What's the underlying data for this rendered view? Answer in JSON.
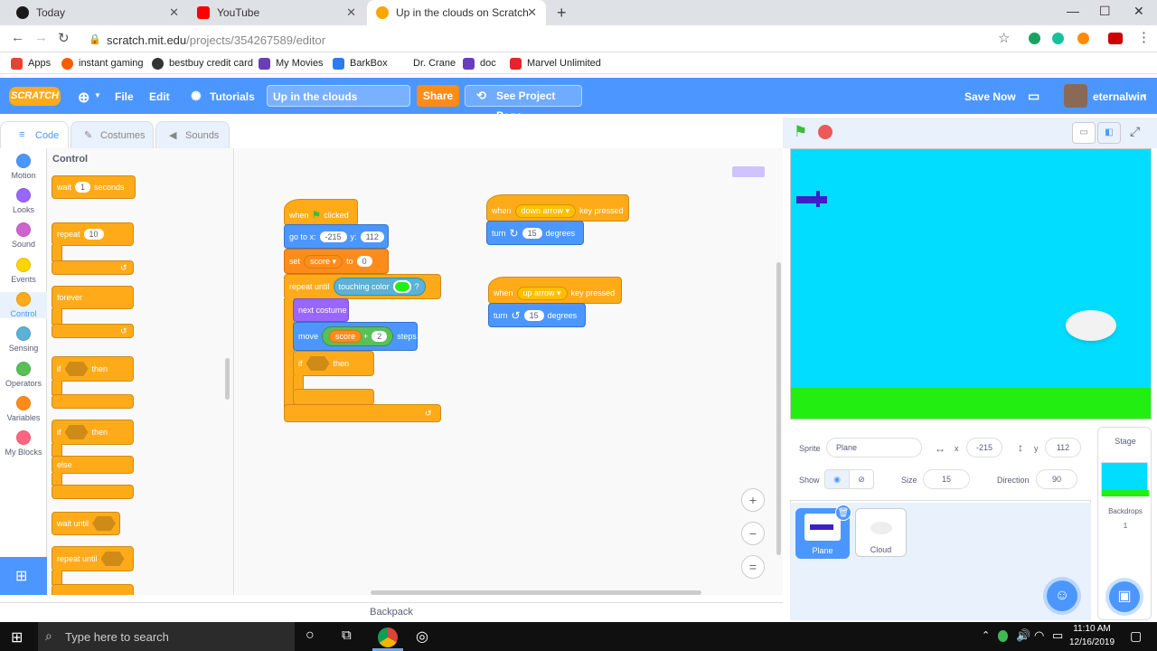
{
  "browser": {
    "tabs": [
      {
        "title": "Today",
        "icon_color": "#1a1a1a"
      },
      {
        "title": "YouTube",
        "icon_color": "#ff0000"
      },
      {
        "title": "Up in the clouds on Scratch",
        "icon_color": "#ffa500"
      }
    ],
    "url_host": "scratch.mit.edu",
    "url_path": "/projects/354267589/editor",
    "bookmarks": [
      {
        "label": "Apps",
        "icon_color": "#e94235"
      },
      {
        "label": "instant gaming",
        "icon_color": "#ff5a00"
      },
      {
        "label": "bestbuy credit card",
        "icon_color": "#333333"
      },
      {
        "label": "My Movies",
        "icon_color": "#6a3dbb"
      },
      {
        "label": "BarkBox",
        "icon_color": "#2b7de9"
      },
      {
        "label": "Dr. Crane",
        "icon_color": "#ffffff"
      },
      {
        "label": "doc",
        "icon_color": "#6a3dbb"
      },
      {
        "label": "Marvel Unlimited",
        "icon_color": "#e62429"
      }
    ]
  },
  "menubar": {
    "logo": "SCRATCH",
    "file": "File",
    "edit": "Edit",
    "tutorials": "Tutorials",
    "project_title": "Up in the clouds",
    "share": "Share",
    "see_project": "See Project Page",
    "save_now": "Save Now",
    "username": "eternalwin"
  },
  "editor_tabs": {
    "code": "Code",
    "costumes": "Costumes",
    "sounds": "Sounds"
  },
  "categories": [
    {
      "label": "Motion",
      "color": "#4c97ff"
    },
    {
      "label": "Looks",
      "color": "#9966ff"
    },
    {
      "label": "Sound",
      "color": "#cf63cf"
    },
    {
      "label": "Events",
      "color": "#ffd500"
    },
    {
      "label": "Control",
      "color": "#ffab19"
    },
    {
      "label": "Sensing",
      "color": "#5cb1d6"
    },
    {
      "label": "Operators",
      "color": "#59c059"
    },
    {
      "label": "Variables",
      "color": "#ff8c1a"
    },
    {
      "label": "My Blocks",
      "color": "#ff6680"
    }
  ],
  "palette": {
    "heading": "Control",
    "wait": "wait",
    "wait_val": "1",
    "seconds": "seconds",
    "repeat": "repeat",
    "repeat_val": "10",
    "forever": "forever",
    "if": "if",
    "then": "then",
    "if2": "if",
    "then2": "then",
    "else": "else",
    "wait_until": "wait until",
    "repeat_until": "repeat until"
  },
  "script1": {
    "when": "when",
    "clicked": "clicked",
    "goto": "go to x:",
    "x_val": "-215",
    "y": "y:",
    "y_val": "112",
    "set": "set",
    "var": "score",
    "to": "to",
    "set_val": "0",
    "repeat_until": "repeat until",
    "touching_color": "touching color",
    "q": "?",
    "next_costume": "next costume",
    "move": "move",
    "move_var": "score",
    "plus": "+",
    "move_val": "2",
    "steps": "steps",
    "if": "if",
    "then": "then"
  },
  "script2": {
    "when": "when",
    "key": "down arrow",
    "key_pressed": "key pressed",
    "turn": "turn",
    "deg_val": "15",
    "degrees": "degrees"
  },
  "script3": {
    "when": "when",
    "key": "up arrow",
    "key_pressed": "key pressed",
    "turn": "turn",
    "deg_val": "15",
    "degrees": "degrees"
  },
  "workspace": {
    "zoom_in": "+",
    "zoom_out": "−",
    "reset": "="
  },
  "backpack": "Backpack",
  "sprite_info": {
    "sprite_label": "Sprite",
    "sprite_name": "Plane",
    "x_label": "x",
    "x": "-215",
    "y_label": "y",
    "y": "112",
    "show_label": "Show",
    "size_label": "Size",
    "size": "15",
    "direction_label": "Direction",
    "direction": "90"
  },
  "sprites": [
    {
      "name": "Plane"
    },
    {
      "name": "Cloud"
    }
  ],
  "stage_panel": {
    "title": "Stage",
    "backdrops_label": "Backdrops",
    "backdrops_count": "1"
  },
  "taskbar": {
    "search_placeholder": "Type here to search",
    "time": "11:10 AM",
    "date": "12/16/2019"
  }
}
